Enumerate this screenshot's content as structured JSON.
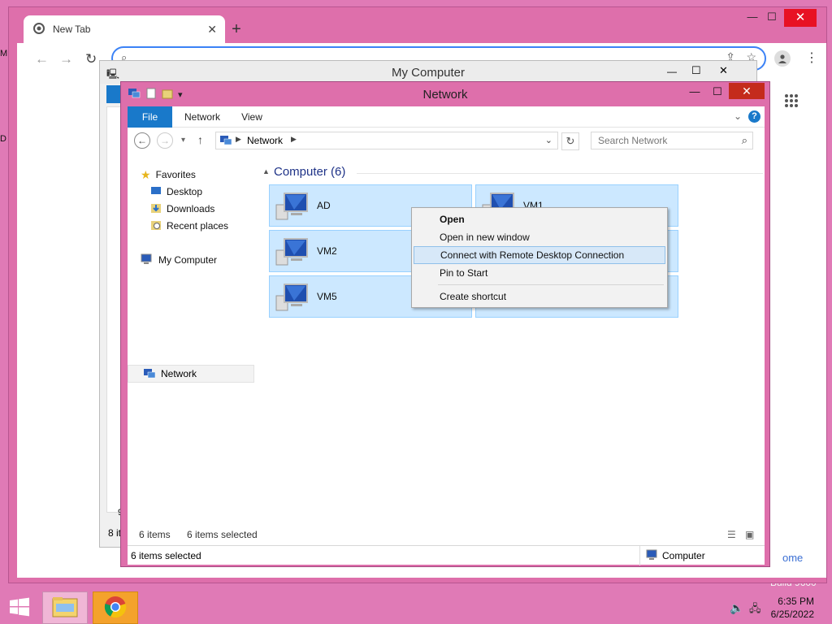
{
  "desktop": {
    "frag_m": "M",
    "frag_d": "D",
    "build_text": "Build 9600"
  },
  "chrome": {
    "tab_title": "New Tab",
    "tab_close": "✕",
    "new_tab_symbol": "+",
    "minimize": "—",
    "maximize": "☐",
    "close": "✕",
    "welcome_fragment": "ome"
  },
  "my_computer": {
    "title": "My Computer",
    "minimize": "—",
    "maximize": "☐",
    "close": "✕",
    "status_fragment": "8 it",
    "fragment_9": "9"
  },
  "network_window": {
    "title": "Network",
    "minimize": "—",
    "maximize": "☐",
    "close": "✕",
    "ribbon_tabs": [
      "File",
      "Network",
      "View"
    ],
    "address_path": "Network",
    "search_placeholder": "Search Network",
    "nav": {
      "favorites": "Favorites",
      "desktop": "Desktop",
      "downloads": "Downloads",
      "recent": "Recent places",
      "my_computer": "My Computer",
      "network": "Network"
    },
    "group_header": "Computer (6)",
    "computers": [
      "AD",
      "VM1",
      "VM2",
      "VM5"
    ],
    "status_items": "6 items",
    "status_selected": "6 items selected",
    "statusbar_left": "6 items selected",
    "statusbar_right": "Computer"
  },
  "context_menu": {
    "items": [
      "Open",
      "Open in new window",
      "Connect with Remote Desktop Connection",
      "Pin to Start",
      "Create shortcut"
    ],
    "highlighted_index": 2
  },
  "taskbar": {
    "time": "6:35 PM",
    "date": "6/25/2022"
  },
  "colors": {
    "accent_pink": "#e07ab6",
    "file_tab_blue": "#1979ca",
    "selection_blue": "#cce8ff",
    "close_red": "#c42b1c"
  }
}
